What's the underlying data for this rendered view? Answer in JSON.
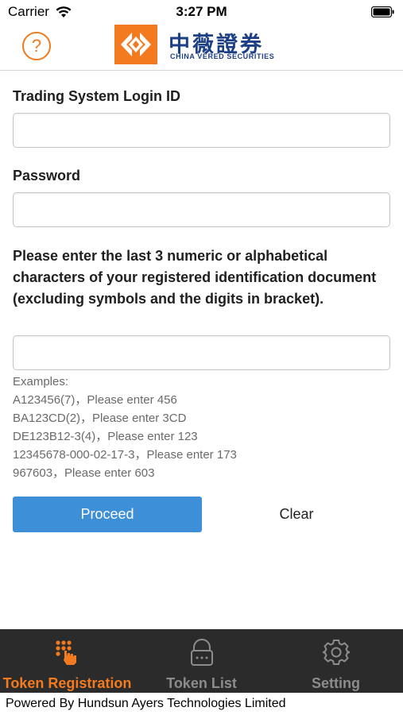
{
  "status_bar": {
    "carrier": "Carrier",
    "time": "3:27 PM",
    "wifi_icon": "wifi-icon",
    "battery_icon": "battery-icon"
  },
  "header": {
    "help_icon": "question-icon",
    "help_label": "?",
    "brand_cn": "中薇證券",
    "brand_en": "CHINA VĔRED SECURITIES"
  },
  "form": {
    "login_label": "Trading System Login ID",
    "login_value": "",
    "password_label": "Password",
    "password_value": "",
    "instructions": "Please enter the last 3 numeric or alphabetical characters of your registered identification document (excluding symbols and the digits in bracket).",
    "id_value": "",
    "examples": [
      "Examples:",
      "A123456(7)，Please enter 456",
      "BA123CD(2)，Please enter 3CD",
      "DE123B12-3(4)，Please enter 123",
      "12345678-000-02-17-3，Please enter 173",
      "967603，Please enter 603"
    ],
    "proceed_label": "Proceed",
    "clear_label": "Clear"
  },
  "tabs": [
    {
      "label": "Token Registration",
      "icon": "keypad-hand-icon",
      "active": true
    },
    {
      "label": "Token List",
      "icon": "lock-icon",
      "active": false
    },
    {
      "label": "Setting",
      "icon": "gear-icon",
      "active": false
    }
  ],
  "footer": {
    "text": "Powered By Hundsun Ayers Technologies Limited"
  },
  "colors": {
    "accent": "#f47a20",
    "button_blue": "#3d8fd7",
    "brand_blue": "#1d3f86",
    "tab_bar_bg": "#2b2b2b"
  }
}
